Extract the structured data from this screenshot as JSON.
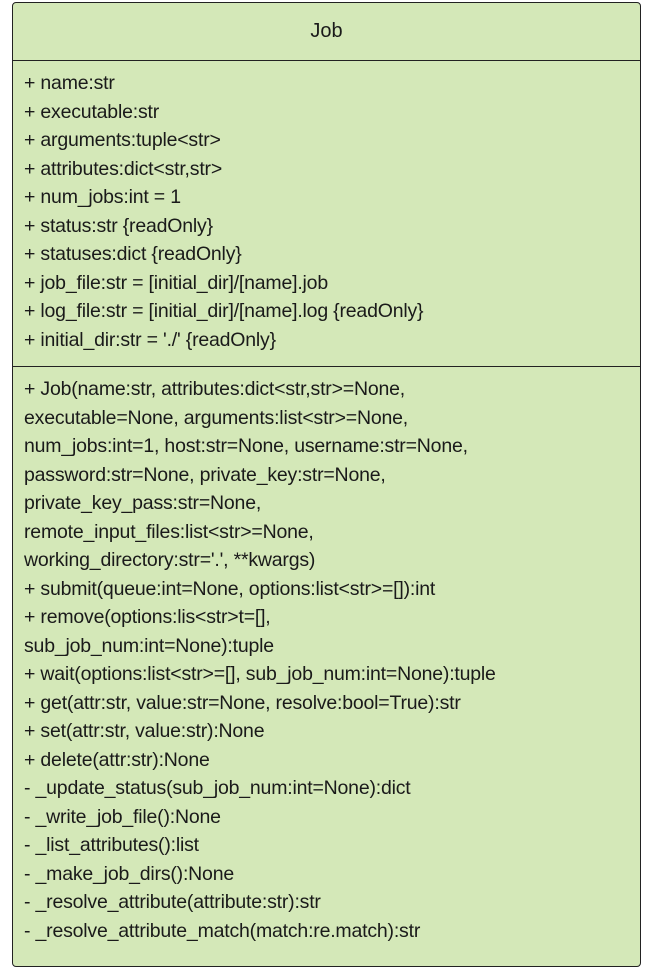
{
  "class_name": "Job",
  "attributes": [
    "+ name:str",
    "+ executable:str",
    "+ arguments:tuple<str>",
    "+ attributes:dict<str,str>",
    "+ num_jobs:int = 1",
    "+ status:str {readOnly}",
    "+ statuses:dict {readOnly}",
    "+ job_file:str = [initial_dir]/[name].job",
    "+ log_file:str = [initial_dir]/[name].log {readOnly}",
    "+ initial_dir:str = './' {readOnly}"
  ],
  "operations": [
    "+ Job(name:str, attributes:dict<str,str>=None,",
    "executable=None, arguments:list<str>=None,",
    "num_jobs:int=1, host:str=None, username:str=None,",
    "password:str=None, private_key:str=None,",
    "private_key_pass:str=None,",
    "remote_input_files:list<str>=None,",
    "working_directory:str='.', **kwargs)",
    "+ submit(queue:int=None, options:list<str>=[]):int",
    "+ remove(options:lis<str>t=[],",
    "sub_job_num:int=None):tuple",
    "+ wait(options:list<str>=[], sub_job_num:int=None):tuple",
    "+ get(attr:str, value:str=None, resolve:bool=True):str",
    "+ set(attr:str, value:str):None",
    "+ delete(attr:str):None",
    "- _update_status(sub_job_num:int=None):dict",
    "- _write_job_file():None",
    "- _list_attributes():list",
    "- _make_job_dirs():None",
    "- _resolve_attribute(attribute:str):str",
    "- _resolve_attribute_match(match:re.match):str"
  ],
  "colors": {
    "fill": "#d4e8b8",
    "border": "#222222",
    "text": "#1a1a1a"
  }
}
